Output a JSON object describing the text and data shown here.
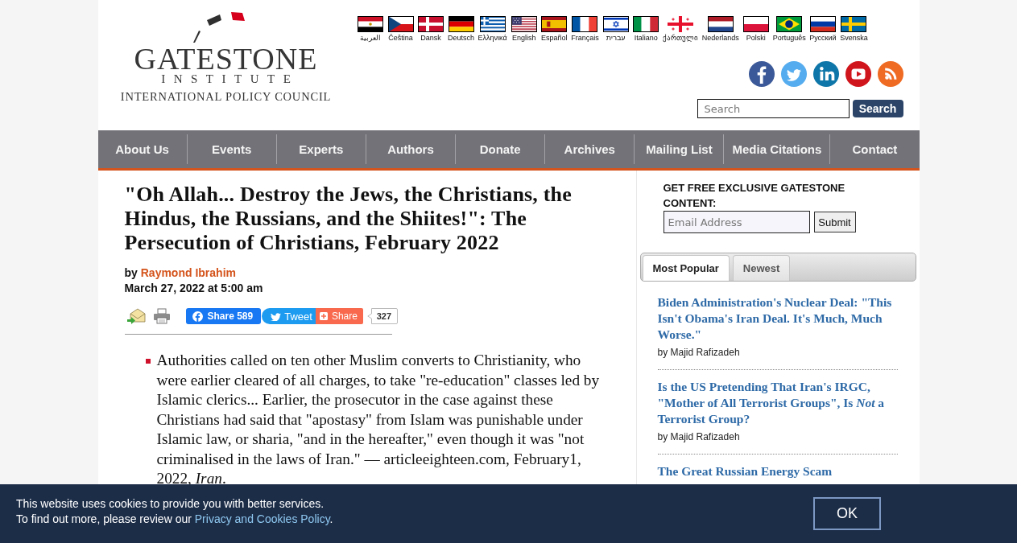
{
  "header": {
    "logo": {
      "name": "GATESTONE",
      "subtitle": "INSTITUTE",
      "tagline": "INTERNATIONAL POLICY COUNCIL"
    },
    "languages": [
      "العربية",
      "Čeština",
      "Dansk",
      "Deutsch",
      "Ελληνικά",
      "English",
      "Español",
      "Français",
      "עברית",
      "Italiano",
      "ქართული",
      "Nederlands",
      "Polski",
      "Português",
      "Русский",
      "Svenska"
    ],
    "search": {
      "placeholder": "Search",
      "button": "Search"
    }
  },
  "nav": [
    "About Us",
    "Events",
    "Experts",
    "Authors",
    "Donate",
    "Archives",
    "Mailing List",
    "Media Citations",
    "Contact"
  ],
  "article": {
    "title": "\"Oh Allah... Destroy the Jews, the Christians, the Hindus, the Russians, and the Shiites!\": The Persecution of Christians, February 2022",
    "byline": "by",
    "author": "Raymond Ibrahim",
    "date": "March 27, 2022 at 5:00 am",
    "share": {
      "facebook": "Share",
      "facebook_count": "589",
      "tweet": "Tweet",
      "share": "Share",
      "count": "327"
    },
    "items": [
      "Authorities called on ten other Muslim converts to Christianity, who were earlier cleared of all charges, to take \"re-education\" classes led by Islamic clerics... Earlier, the prosecutor in the case against these Christians had said that \"apostasy\" from Islam was punishable under Islamic law, or sharia, \"and in the hereafter,\" even though it was \"not criminalised in the laws of Iran.\" — articleeighteen.com, February1, 2022, *Iran*."
    ]
  },
  "sidebar": {
    "signup": {
      "heading": "GET FREE EXCLUSIVE GATESTONE CONTENT:",
      "placeholder": "Email Address",
      "button": "Submit"
    },
    "tabs": [
      {
        "label": "Most Popular",
        "selected": true
      },
      {
        "label": "Newest",
        "selected": false
      }
    ],
    "articles": [
      {
        "title": "Biden Administration's Nuclear Deal: \"This Isn't Obama's Iran Deal. It's Much, Much Worse.\"",
        "byline": "by Majid Rafizadeh"
      },
      {
        "title": "Is the US Pretending That Iran's IRGC, \"Mother of All Terrorist Groups\", Is *Not* a Terrorist Group?",
        "byline": "by Majid Rafizadeh"
      },
      {
        "title": "The Great Russian Energy Scam"
      }
    ]
  },
  "cookie_notice": {
    "line1": "This website uses cookies to provide you with better services.",
    "line2": "To find out more, please review our",
    "link": "Privacy and Cookies Policy",
    "line2_end": ".",
    "button": "OK"
  }
}
